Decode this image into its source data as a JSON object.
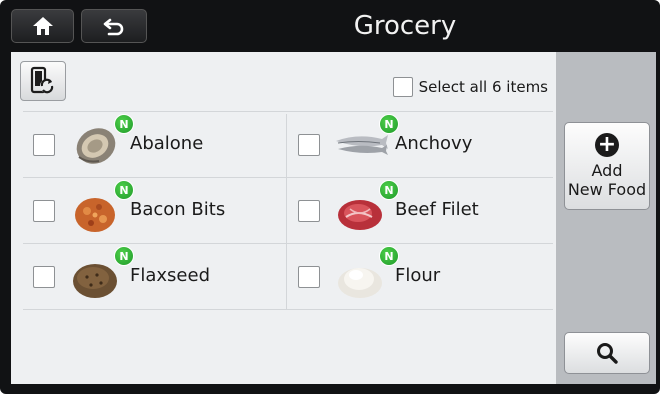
{
  "header": {
    "title": "Grocery",
    "home_icon": "home-icon",
    "back_icon": "back-arrow-icon"
  },
  "toolbar": {
    "sync_icon": "phone-sync-icon",
    "select_all_label": "Select all 6 items",
    "select_all_checked": false
  },
  "items": [
    {
      "label": "Abalone",
      "badge": "N",
      "checked": false,
      "image": "abalone-image"
    },
    {
      "label": "Anchovy",
      "badge": "N",
      "checked": false,
      "image": "anchovy-image"
    },
    {
      "label": "Bacon Bits",
      "badge": "N",
      "checked": false,
      "image": "bacon-bits-image"
    },
    {
      "label": "Beef Filet",
      "badge": "N",
      "checked": false,
      "image": "beef-filet-image"
    },
    {
      "label": "Flaxseed",
      "badge": "N",
      "checked": false,
      "image": "flaxseed-image"
    },
    {
      "label": "Flour",
      "badge": "N",
      "checked": false,
      "image": "flour-image"
    }
  ],
  "side": {
    "add_label_line1": "Add",
    "add_label_line2": "New Food",
    "add_icon": "plus-circle-icon",
    "search_icon": "search-icon"
  },
  "colors": {
    "badge_green": "#2fb33a",
    "panel_bg": "#eef0f2",
    "side_bg": "#b9bcc0",
    "frame": "#111214"
  }
}
